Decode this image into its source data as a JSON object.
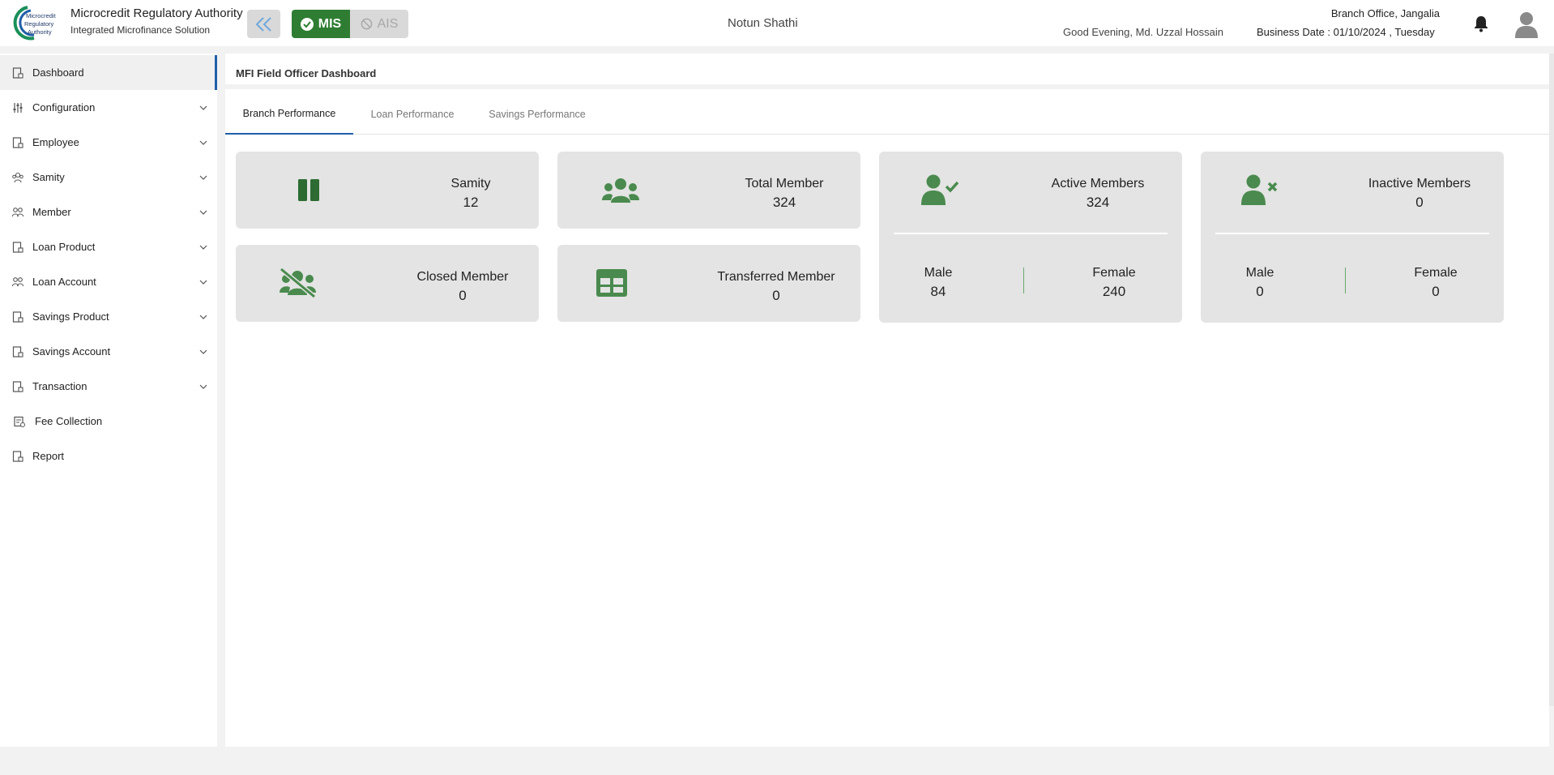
{
  "header": {
    "org_name": "Microcredit Regulatory Authority",
    "org_sub": "Integrated Microfinance Solution",
    "logo_text": [
      "Microcredit",
      "Regulatory",
      "Authority"
    ],
    "mode_mis": "MIS",
    "mode_ais": "AIS",
    "center_title": "Notun Shathi",
    "greeting": "Good Evening, Md. Uzzal Hossain",
    "branch": "Branch Office, Jangalia",
    "business_date": "Business Date : 01/10/2024 , Tuesday",
    "accent_color": "#2e7d32"
  },
  "sidebar": {
    "items": [
      {
        "label": "Dashboard",
        "icon": "document-icon",
        "expandable": false,
        "active": true
      },
      {
        "label": "Configuration",
        "icon": "sliders-icon",
        "expandable": true
      },
      {
        "label": "Employee",
        "icon": "document-icon",
        "expandable": true
      },
      {
        "label": "Samity",
        "icon": "group-icon",
        "expandable": true
      },
      {
        "label": "Member",
        "icon": "members-icon",
        "expandable": true
      },
      {
        "label": "Loan Product",
        "icon": "document-icon",
        "expandable": true
      },
      {
        "label": "Loan Account",
        "icon": "members-icon",
        "expandable": true
      },
      {
        "label": "Savings Product",
        "icon": "document-icon",
        "expandable": true
      },
      {
        "label": "Savings Account",
        "icon": "document-icon",
        "expandable": true
      },
      {
        "label": "Transaction",
        "icon": "document-icon",
        "expandable": true
      },
      {
        "label": "Fee Collection",
        "icon": "fee-icon",
        "expandable": false
      },
      {
        "label": "Report",
        "icon": "document-icon",
        "expandable": false
      }
    ]
  },
  "main": {
    "title": "MFI Field Officer Dashboard",
    "tabs": [
      {
        "label": "Branch Performance",
        "active": true
      },
      {
        "label": "Loan Performance",
        "active": false
      },
      {
        "label": "Savings Performance",
        "active": false
      }
    ],
    "cards": {
      "samity": {
        "title": "Samity",
        "value": "12"
      },
      "total_member": {
        "title": "Total Member",
        "value": "324"
      },
      "closed_member": {
        "title": "Closed Member",
        "value": "0"
      },
      "transferred_member": {
        "title": "Transferred Member",
        "value": "0"
      },
      "active_members": {
        "title": "Active Members",
        "value": "324",
        "male_label": "Male",
        "male_value": "84",
        "female_label": "Female",
        "female_value": "240"
      },
      "inactive_members": {
        "title": "Inactive Members",
        "value": "0",
        "male_label": "Male",
        "male_value": "0",
        "female_label": "Female",
        "female_value": "0"
      }
    },
    "card_color": "#e3e4e3",
    "icon_color": "#4a8a4e"
  }
}
